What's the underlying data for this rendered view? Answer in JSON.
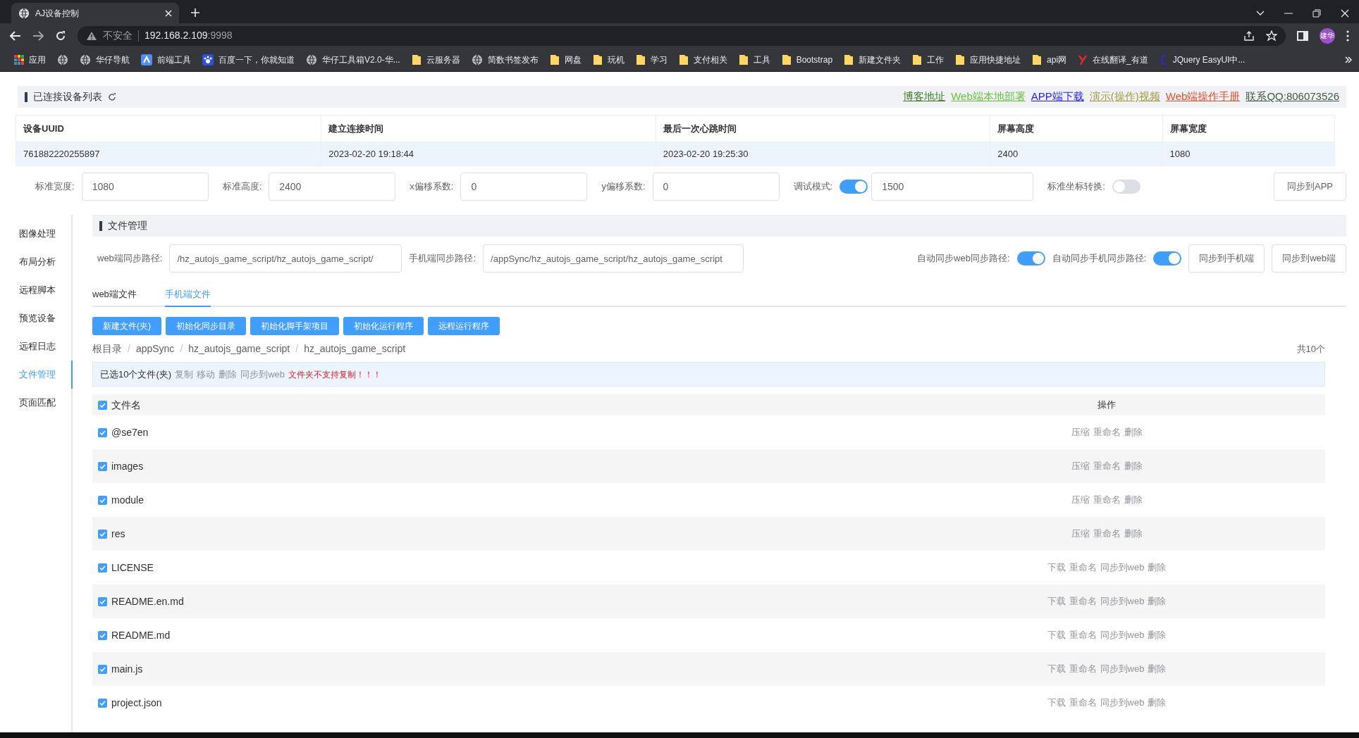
{
  "browser": {
    "tabs": [
      {
        "title": "AJ设备控制",
        "selected": true
      }
    ],
    "address": {
      "security": "不安全",
      "host": "192.168.2.109",
      "port": ":9998"
    },
    "avatar": "建华",
    "bookmarks": [
      {
        "label": "应用",
        "kind": "grid"
      },
      {
        "kind": "globe"
      },
      {
        "label": "华仔导航",
        "kind": "globe"
      },
      {
        "label": "前端工具",
        "kind": "tile"
      },
      {
        "label": "百度一下，你就知道",
        "kind": "paw"
      },
      {
        "label": "华仔工具箱V2.0-华...",
        "kind": "globe"
      },
      {
        "label": "云服务器",
        "kind": "folder"
      },
      {
        "label": "简数书签发布",
        "kind": "globe"
      },
      {
        "label": "网盘",
        "kind": "folder"
      },
      {
        "label": "玩机",
        "kind": "folder"
      },
      {
        "label": "学习",
        "kind": "folder"
      },
      {
        "label": "支付相关",
        "kind": "folder"
      },
      {
        "label": "工具",
        "kind": "folder"
      },
      {
        "label": "Bootstrap",
        "kind": "folder"
      },
      {
        "label": "新建文件夹",
        "kind": "folder"
      },
      {
        "label": "工作",
        "kind": "folder"
      },
      {
        "label": "应用快捷地址",
        "kind": "folder"
      },
      {
        "label": "api网",
        "kind": "folder"
      },
      {
        "label": "在线翻译_有道",
        "kind": "red"
      },
      {
        "label": "JQuery EasyUI中...",
        "kind": "blue"
      }
    ]
  },
  "header": {
    "title": "已连接设备列表",
    "links": [
      {
        "text": "博客地址",
        "color": "#3b7d23"
      },
      {
        "text": "Web端本地部署",
        "color": "#67c23a"
      },
      {
        "text": "APP端下载",
        "color": "#1f1fff"
      },
      {
        "text": "演示(操作)视频",
        "color": "#a39a3c"
      },
      {
        "text": "Web端操作手册",
        "color": "#e0502a"
      },
      {
        "text": "联系QQ:806073526",
        "color": "#3d5a3d"
      }
    ]
  },
  "device_table": {
    "columns": [
      "设备UUID",
      "建立连接时间",
      "最后一次心跳时间",
      "屏幕高度",
      "屏幕宽度"
    ],
    "rows": [
      [
        "761882220255897",
        "2023-02-20 19:18:44",
        "2023-02-20 19:25:30",
        "2400",
        "1080"
      ]
    ]
  },
  "settings": [
    {
      "kind": "field",
      "label": "标准宽度:",
      "value": "1080"
    },
    {
      "kind": "field",
      "label": "标准高度:",
      "value": "2400"
    },
    {
      "kind": "field",
      "label": "x偏移系数:",
      "value": "0"
    },
    {
      "kind": "field",
      "label": "y偏移系数:",
      "value": "0"
    },
    {
      "kind": "toggle",
      "label": "调试模式:",
      "on": true
    },
    {
      "kind": "field",
      "value": "1500"
    },
    {
      "kind": "toggle",
      "label": "标准坐标转换:",
      "on": false
    },
    {
      "kind": "button",
      "label": "同步到APP"
    }
  ],
  "sidebar": {
    "items": [
      {
        "label": "图像处理",
        "selected": false
      },
      {
        "label": "布局分析",
        "selected": false
      },
      {
        "label": "远程脚本",
        "selected": false
      },
      {
        "label": "预览设备",
        "selected": false
      },
      {
        "label": "远程日志",
        "selected": false
      },
      {
        "label": "文件管理",
        "selected": true
      },
      {
        "label": "页面匹配",
        "selected": false
      }
    ]
  },
  "file_panel": {
    "title": "文件管理",
    "sync": [
      {
        "kind": "field",
        "label": "web端同步路径:",
        "value": "/hz_autojs_game_script/hz_autojs_game_script/"
      },
      {
        "kind": "field",
        "label": "手机端同步路径:",
        "value": "/appSync/hz_autojs_game_script/hz_autojs_game_script"
      },
      {
        "kind": "toggle",
        "label": "自动同步web同步路径:",
        "on": true
      },
      {
        "kind": "toggle",
        "label": "自动同步手机同步路径:",
        "on": true
      },
      {
        "kind": "button",
        "label": "同步到手机端"
      },
      {
        "kind": "button",
        "label": "同步到web端"
      }
    ],
    "tabs": [
      {
        "label": "web端文件",
        "selected": false
      },
      {
        "label": "手机端文件",
        "selected": true
      }
    ],
    "actions": [
      "新建文件(夹)",
      "初始化同步目录",
      "初始化脚手架项目",
      "初始化运行程序",
      "远程运行程序"
    ],
    "breadcrumb": {
      "separator": "/",
      "items": [
        "根目录",
        "appSync",
        "hz_autojs_game_script",
        "hz_autojs_game_script"
      ]
    },
    "count": "共10个",
    "selection": {
      "text": "已选10个文件(夹)",
      "actions": [
        "复制",
        "移动",
        "删除",
        "同步到web"
      ],
      "warning": "文件夹不支持复制！！！"
    },
    "table": {
      "columns": [
        "文件名",
        "操作"
      ],
      "all_checked": true,
      "rows": [
        {
          "name": "@se7en",
          "checked": true,
          "actions": [
            "压缩",
            "重命名",
            "删除"
          ]
        },
        {
          "name": "images",
          "checked": true,
          "actions": [
            "压缩",
            "重命名",
            "删除"
          ]
        },
        {
          "name": "module",
          "checked": true,
          "actions": [
            "压缩",
            "重命名",
            "删除"
          ]
        },
        {
          "name": "res",
          "checked": true,
          "actions": [
            "压缩",
            "重命名",
            "删除"
          ]
        },
        {
          "name": "LICENSE",
          "checked": true,
          "actions": [
            "下载",
            "重命名",
            "同步到web",
            "删除"
          ]
        },
        {
          "name": "README.en.md",
          "checked": true,
          "actions": [
            "下载",
            "重命名",
            "同步到web",
            "删除"
          ]
        },
        {
          "name": "README.md",
          "checked": true,
          "actions": [
            "下载",
            "重命名",
            "同步到web",
            "删除"
          ]
        },
        {
          "name": "main.js",
          "checked": true,
          "actions": [
            "下载",
            "重命名",
            "同步到web",
            "删除"
          ]
        },
        {
          "name": "project.json",
          "checked": true,
          "actions": [
            "下载",
            "重命名",
            "同步到web",
            "删除"
          ]
        }
      ]
    }
  }
}
